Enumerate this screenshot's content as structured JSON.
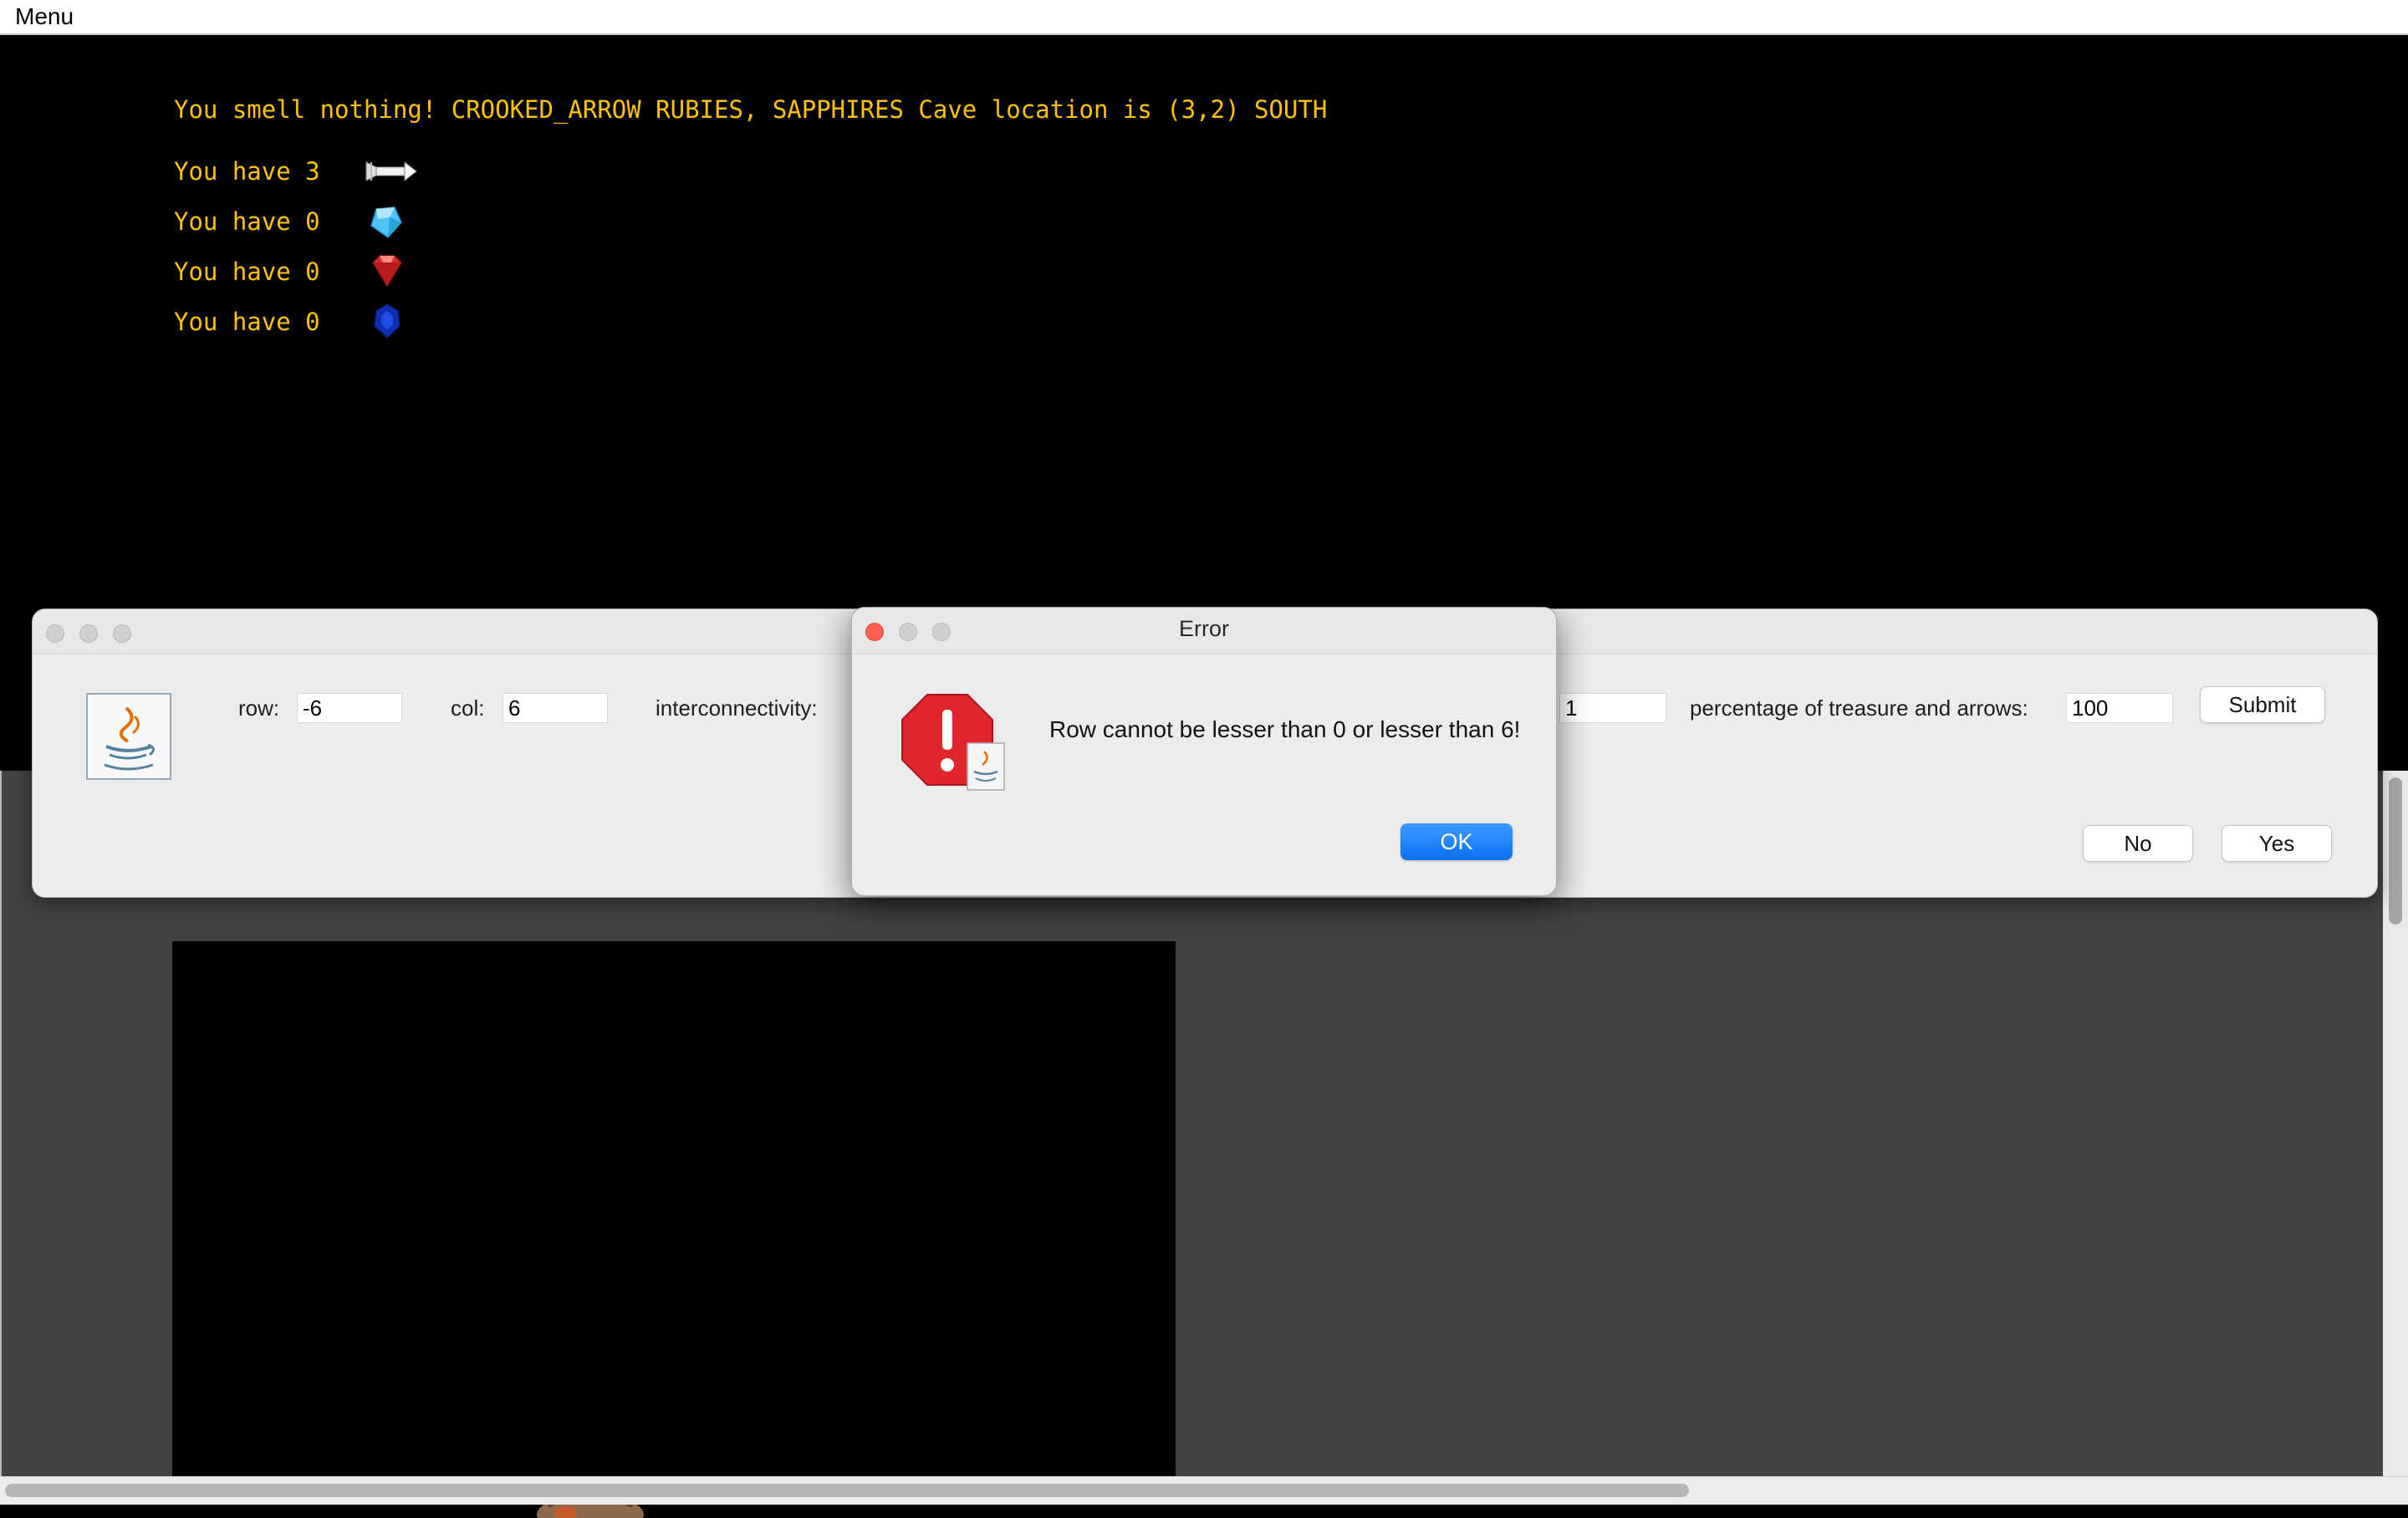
{
  "menubar": {
    "menu_label": "Menu"
  },
  "status": {
    "message": "You smell nothing! CROOKED_ARROW RUBIES, SAPPHIRES Cave location is (3,2) SOUTH",
    "inventory": [
      {
        "text": "You have 3",
        "icon": "arrow-icon"
      },
      {
        "text": "You have 0",
        "icon": "diamond-icon"
      },
      {
        "text": "You have 0",
        "icon": "ruby-icon"
      },
      {
        "text": "You have 0",
        "icon": "sapphire-icon"
      }
    ]
  },
  "settings": {
    "row_label": "row:",
    "row_value": "-6",
    "col_label": "col:",
    "col_value": "6",
    "interconnectivity_label": "interconnectivity:",
    "hidden_field_value": "1",
    "percentage_label": "percentage of treasure and arrows:",
    "percentage_value": "100",
    "submit_label": "Submit",
    "no_label": "No",
    "yes_label": "Yes"
  },
  "error_dialog": {
    "title": "Error",
    "message": "Row cannot be lesser than 0 or lesser than 6!",
    "ok_label": "OK",
    "icon": "error-stop-icon"
  },
  "colors": {
    "status_text": "#ffc300",
    "accent": "#0a6ff5",
    "error_red": "#e0262c"
  }
}
